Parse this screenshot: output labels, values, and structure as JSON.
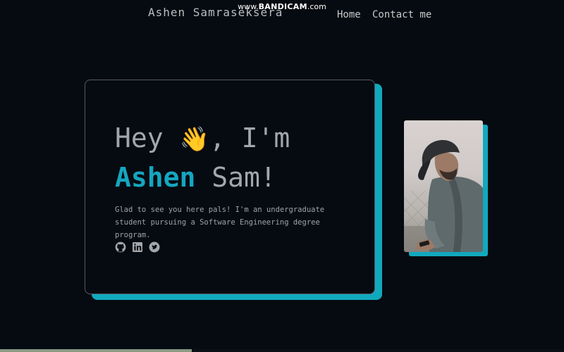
{
  "header": {
    "logo": "Ashen Samraseksera",
    "nav": [
      {
        "label": "Home"
      },
      {
        "label": "Contact me"
      }
    ]
  },
  "watermark": {
    "prefix": "www.",
    "brand": "BANDICAM",
    "suffix": ".com"
  },
  "hero": {
    "line1_before": "Hey ",
    "wave_emoji": "👋",
    "line1_after": ", I'm",
    "name_accent": "Ashen",
    "name_rest": " Sam!",
    "intro": "Glad to see you here pals! I'm an undergraduate student pursuing a Software Engineering degree program.",
    "socials": [
      {
        "icon": "github-icon"
      },
      {
        "icon": "linkedin-icon"
      },
      {
        "icon": "twitter-icon"
      }
    ]
  },
  "colors": {
    "background": "#060b11",
    "accent": "#11a9be",
    "text": "#a3a7ab"
  },
  "progress": {
    "fraction": 0.34
  }
}
